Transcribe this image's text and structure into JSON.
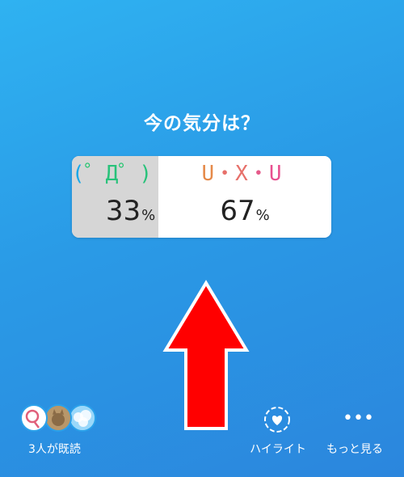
{
  "story": {
    "question": "今の気分は？"
  },
  "poll": {
    "options": [
      {
        "parts": [
          "(",
          "゜",
          "Д",
          "゜",
          ")"
        ],
        "percent": "33",
        "percent_value": 33
      },
      {
        "parts": [
          "U",
          "・",
          "X",
          "・",
          "U"
        ],
        "percent": "67",
        "percent_value": 67
      }
    ],
    "percent_sign": "%"
  },
  "footer": {
    "seen_label": "3人が既読",
    "highlight_label": "ハイライト",
    "more_label": "もっと見る",
    "more_glyph": "•••"
  },
  "icons": {
    "arrow": "arrow-up-icon",
    "highlight": "heart-circle-icon",
    "more": "more-dots-icon"
  },
  "colors": {
    "arrow_fill": "#ff0000",
    "option_a_bg": "#d6d6d6",
    "option_b_bg": "#ffffff"
  }
}
